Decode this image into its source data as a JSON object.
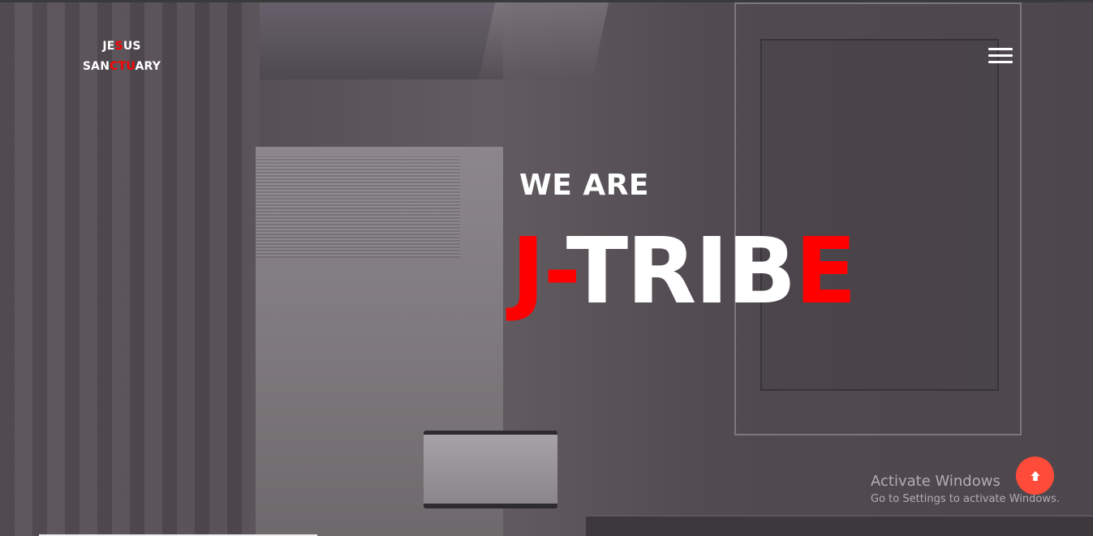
{
  "logo": {
    "part1": "JE",
    "part2": "S",
    "part3": "US",
    "part4": "SAN",
    "part5": "CTU",
    "part6": "ARY"
  },
  "menu": {
    "icon": "hamburger-menu-icon"
  },
  "hero": {
    "subtitle": "WE ARE",
    "title_red_1": "J-",
    "title_white": "TRIB",
    "title_red_2": "E"
  },
  "watermark": {
    "title": "Activate Windows",
    "subtitle": "Go to Settings to activate Windows."
  },
  "scroll_top": {
    "icon": "arrow-up-icon"
  },
  "colors": {
    "accent": "#ff0000",
    "scroll_button": "#ff4b3a",
    "text": "#ffffff"
  }
}
